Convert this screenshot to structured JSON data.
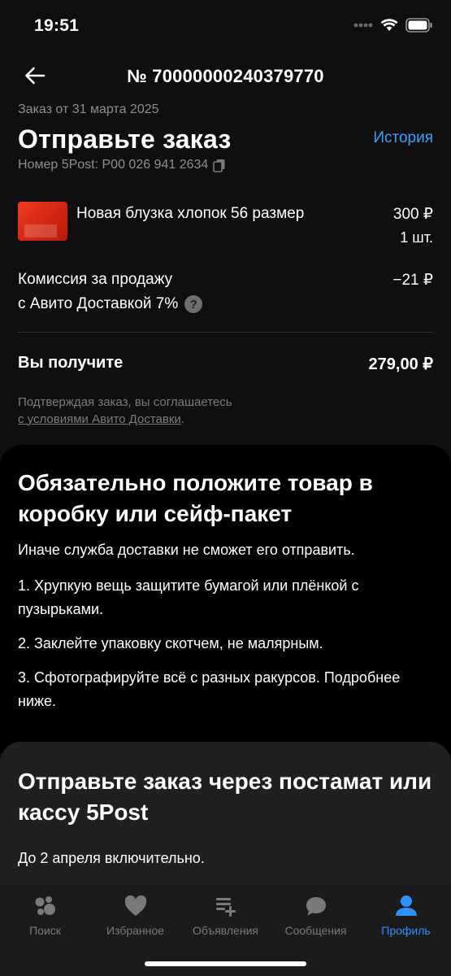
{
  "status_bar": {
    "time": "19:51"
  },
  "header": {
    "title": "№ 70000000240379770",
    "back_icon": "arrow-left-icon"
  },
  "order": {
    "date_text": "Заказ от 31 марта 2025",
    "title": "Отправьте заказ",
    "history_label": "История",
    "tracking_text": "Номер 5Post: P00 026 941 2634"
  },
  "product": {
    "name": "Новая блузка хлопок 56 размер",
    "price": "300 ₽",
    "quantity": "1 шт."
  },
  "commission": {
    "line1": "Комиссия за продажу",
    "line2": "с Авито Доставкой 7%",
    "value": "−21 ₽"
  },
  "total": {
    "label": "Вы получите",
    "value": "279,00 ₽"
  },
  "terms": {
    "text": "Подтверждая заказ, вы соглашаетесь",
    "link": "с условиями Авито Доставки",
    "suffix": "."
  },
  "packaging": {
    "title": "Обязательно положите товар в коробку или сейф-пакет",
    "subtitle": "Иначе служба доставки не сможет его отправить.",
    "steps": [
      "1. Хрупкую вещь защитите бумагой или плёнкой с пузырьками.",
      "2. Заклейте упаковку скотчем, не малярным.",
      "3. Сфотографируйте всё с разных ракурсов. Подробнее ниже."
    ]
  },
  "shipping": {
    "title": "Отправьте заказ через постамат или кассу 5Post",
    "deadline": "До 2 апреля включительно."
  },
  "tab_bar": {
    "items": [
      {
        "label": "Поиск",
        "icon": "search-bubbles-icon"
      },
      {
        "label": "Избранное",
        "icon": "heart-icon"
      },
      {
        "label": "Объявления",
        "icon": "listings-add-icon"
      },
      {
        "label": "Сообщения",
        "icon": "chat-bubble-icon"
      },
      {
        "label": "Профиль",
        "icon": "profile-icon"
      }
    ],
    "active_index": 4
  },
  "colors": {
    "accent": "#3aa0ff",
    "background": "#0f0f0f",
    "card": "#000000",
    "muted": "#8e8e8e"
  }
}
